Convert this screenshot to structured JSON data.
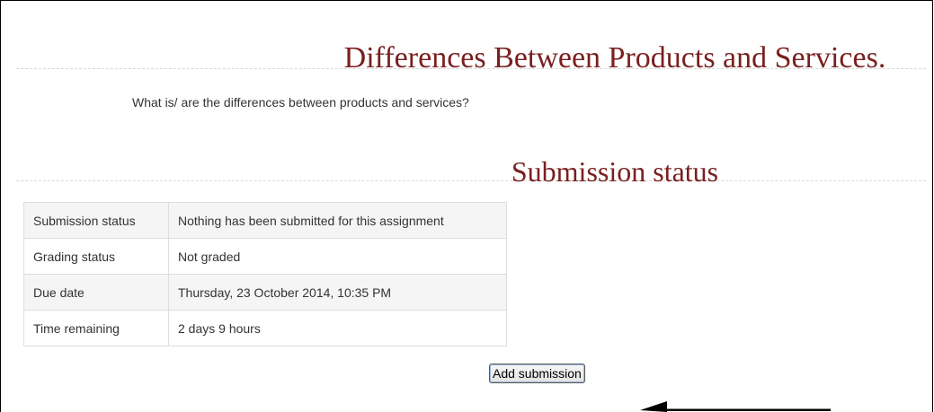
{
  "assignment": {
    "title": "Differences Between Products and Services.",
    "intro": "What is/ are the differences between products and services?"
  },
  "submission": {
    "heading": "Submission status",
    "rows": [
      {
        "label": "Submission status",
        "value": "Nothing has been submitted for this assignment"
      },
      {
        "label": "Grading status",
        "value": "Not graded"
      },
      {
        "label": "Due date",
        "value": "Thursday, 23 October 2014, 10:35 PM"
      },
      {
        "label": "Time remaining",
        "value": "2 days 9 hours"
      }
    ],
    "button_label": "Add submission"
  },
  "colors": {
    "heading": "#7a1f1f",
    "row_stripe": "#f5f5f5",
    "border": "#dddddd"
  },
  "annotation": {
    "icon": "left-arrow-icon"
  }
}
